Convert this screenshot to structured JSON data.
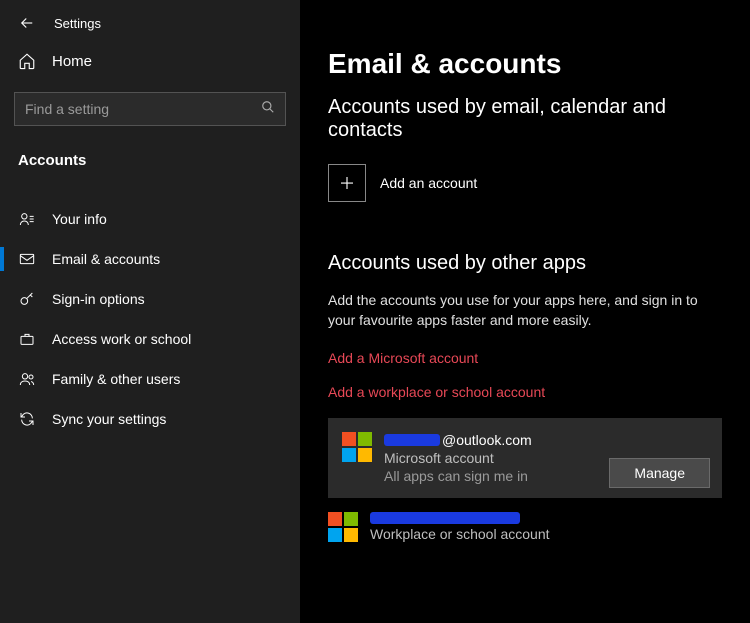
{
  "header": {
    "title": "Settings"
  },
  "sidebar": {
    "home_label": "Home",
    "search_placeholder": "Find a setting",
    "section_label": "Accounts",
    "items": [
      {
        "label": "Your info",
        "icon": "user",
        "active": false
      },
      {
        "label": "Email & accounts",
        "icon": "mail",
        "active": true
      },
      {
        "label": "Sign-in options",
        "icon": "key",
        "active": false
      },
      {
        "label": "Access work or school",
        "icon": "briefcase",
        "active": false
      },
      {
        "label": "Family & other users",
        "icon": "people",
        "active": false
      },
      {
        "label": "Sync your settings",
        "icon": "sync",
        "active": false
      }
    ]
  },
  "content": {
    "page_title": "Email & accounts",
    "section1": {
      "heading": "Accounts used by email, calendar and contacts",
      "add_label": "Add an account"
    },
    "section2": {
      "heading": "Accounts used by other apps",
      "description": "Add the accounts you use for your apps here, and sign in to your favourite apps faster and more easily.",
      "link_ms": "Add a Microsoft account",
      "link_work": "Add a workplace or school account"
    },
    "accounts": [
      {
        "email_suffix": "@outlook.com",
        "type": "Microsoft account",
        "status": "All apps can sign me in",
        "manage_label": "Manage"
      },
      {
        "type": "Workplace or school account"
      }
    ]
  }
}
